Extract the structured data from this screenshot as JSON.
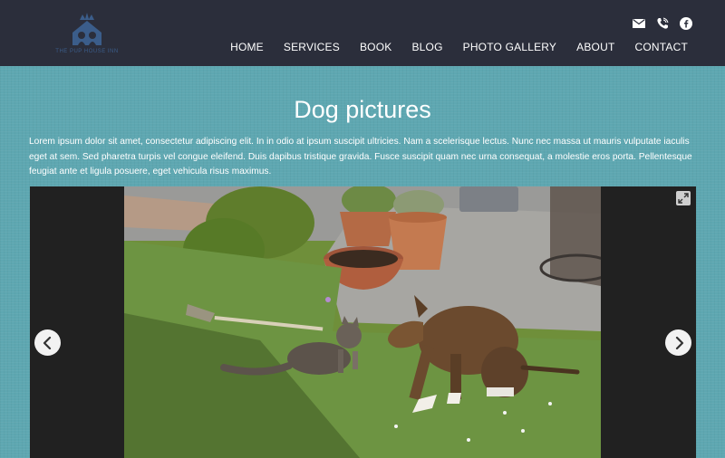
{
  "brand": {
    "logo_text": "THE PUP HOUSE INN"
  },
  "header": {
    "social_icons": [
      "email-icon",
      "phone-icon",
      "facebook-icon"
    ]
  },
  "nav": {
    "items": [
      {
        "label": "HOME"
      },
      {
        "label": "SERVICES"
      },
      {
        "label": "BOOK"
      },
      {
        "label": "BLOG"
      },
      {
        "label": "PHOTO GALLERY"
      },
      {
        "label": "ABOUT"
      },
      {
        "label": "CONTACT"
      }
    ]
  },
  "page": {
    "title": "Dog pictures",
    "intro": "Lorem ipsum dolor sit amet, consectetur adipiscing elit. In in odio at ipsum suscipit ultricies. Nam a scelerisque lectus. Nunc nec massa ut mauris vulputate iaculis eget at sem. Sed pharetra turpis vel congue eleifend. Duis dapibus tristique gravida. Fusce suscipit quam nec urna consequat, a molestie eros porta. Pellentesque feugiat ante et ligula posuere, eget vehicula risus maximus."
  },
  "gallery": {
    "prev_icon": "chevron-left-icon",
    "next_icon": "chevron-right-icon",
    "expand_icon": "expand-icon"
  },
  "colors": {
    "header_bg": "#2b2e3b",
    "page_bg": "#5ea7b1",
    "gallery_bg": "#212121",
    "logo": "#3b5d8a"
  }
}
